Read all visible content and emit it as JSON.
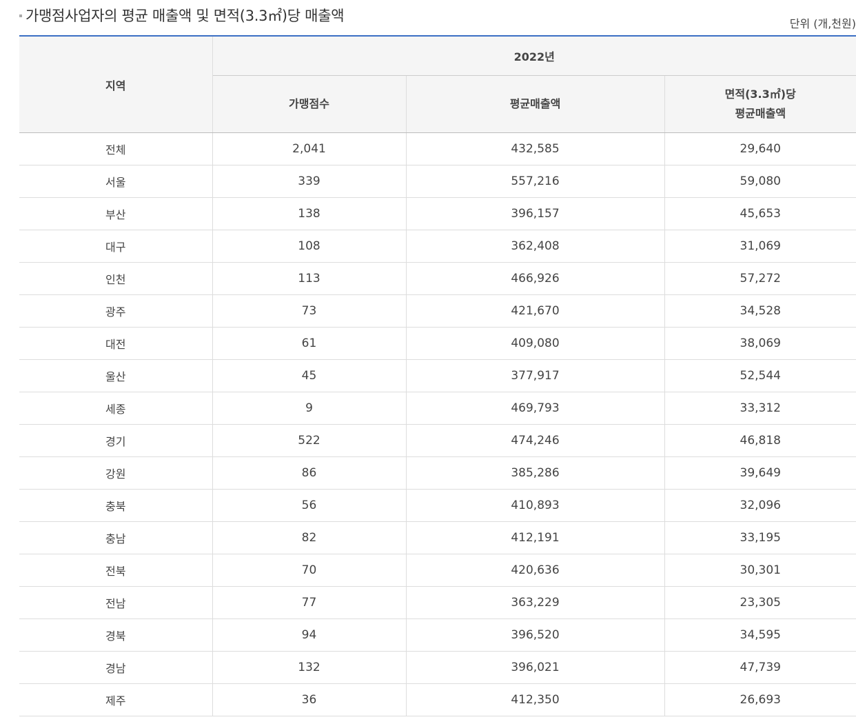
{
  "title": "가맹점사업자의 평균 매출액 및 면적(3.3㎡)당 매출액",
  "unit": "단위 (개,천원)",
  "header": {
    "region": "지역",
    "year": "2022년",
    "col_count": "가맹점수",
    "col_avg_sales": "평균매출액",
    "col_area_line1": "면적(3.3㎡)당",
    "col_area_line2": "평균매출액"
  },
  "rows": [
    {
      "region": "전체",
      "count": "2,041",
      "avg": "432,585",
      "area": "29,640"
    },
    {
      "region": "서울",
      "count": "339",
      "avg": "557,216",
      "area": "59,080"
    },
    {
      "region": "부산",
      "count": "138",
      "avg": "396,157",
      "area": "45,653"
    },
    {
      "region": "대구",
      "count": "108",
      "avg": "362,408",
      "area": "31,069"
    },
    {
      "region": "인천",
      "count": "113",
      "avg": "466,926",
      "area": "57,272"
    },
    {
      "region": "광주",
      "count": "73",
      "avg": "421,670",
      "area": "34,528"
    },
    {
      "region": "대전",
      "count": "61",
      "avg": "409,080",
      "area": "38,069"
    },
    {
      "region": "울산",
      "count": "45",
      "avg": "377,917",
      "area": "52,544"
    },
    {
      "region": "세종",
      "count": "9",
      "avg": "469,793",
      "area": "33,312"
    },
    {
      "region": "경기",
      "count": "522",
      "avg": "474,246",
      "area": "46,818"
    },
    {
      "region": "강원",
      "count": "86",
      "avg": "385,286",
      "area": "39,649"
    },
    {
      "region": "충북",
      "count": "56",
      "avg": "410,893",
      "area": "32,096"
    },
    {
      "region": "충남",
      "count": "82",
      "avg": "412,191",
      "area": "33,195"
    },
    {
      "region": "전북",
      "count": "70",
      "avg": "420,636",
      "area": "30,301"
    },
    {
      "region": "전남",
      "count": "77",
      "avg": "363,229",
      "area": "23,305"
    },
    {
      "region": "경북",
      "count": "94",
      "avg": "396,520",
      "area": "34,595"
    },
    {
      "region": "경남",
      "count": "132",
      "avg": "396,021",
      "area": "47,739"
    },
    {
      "region": "제주",
      "count": "36",
      "avg": "412,350",
      "area": "26,693"
    }
  ]
}
